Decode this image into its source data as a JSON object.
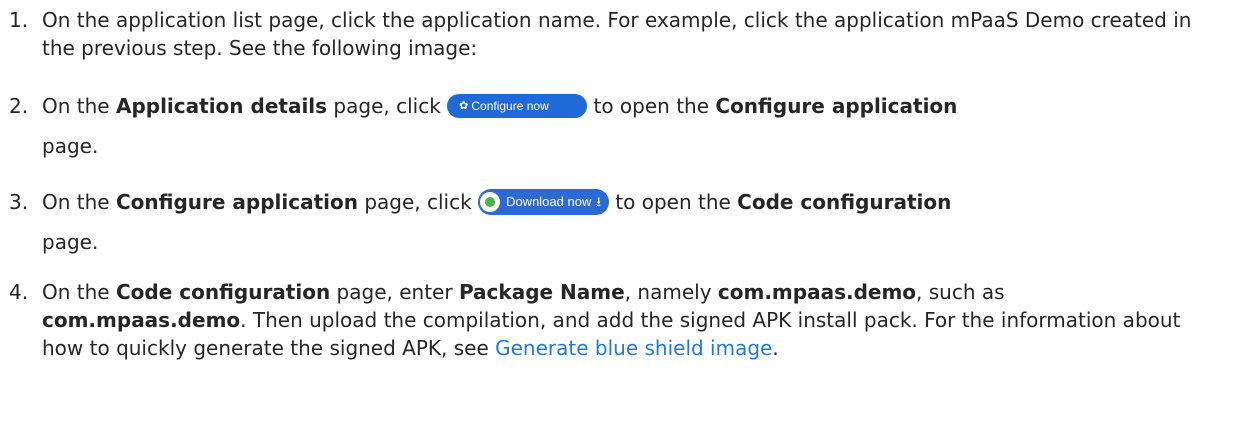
{
  "steps": [
    {
      "number": "1.",
      "text": "On the application list page, click the application name. For example, click the application mPaaS Demo created in the previous step. See the following image:"
    },
    {
      "number": "2.",
      "pre": "On the ",
      "bold1": "Application details",
      "mid": " page, click ",
      "button_label": "Configure now",
      "post": " to open the ",
      "bold2": "Configure application",
      "end": " page."
    },
    {
      "number": "3.",
      "pre": "On the ",
      "bold1": "Configure application",
      "mid": " page, click ",
      "button_label": "Download now",
      "post": " to open the ",
      "bold2": "Code configuration",
      "end": " page."
    },
    {
      "number": "4.",
      "pre": "On the ",
      "bold1": "Code configuration",
      "mid1": " page, enter ",
      "bold2": "Package Name",
      "mid2": ", namely ",
      "bold3": "com.mpaas.demo",
      "mid3": ", such as ",
      "bold4": "com.mpaas.demo",
      "mid4": ". Then upload the compilation, and add the signed APK install pack. For the information about how to quickly generate the signed APK, see ",
      "link": "Generate blue shield image",
      "end": "."
    }
  ],
  "colors": {
    "link": "#1f7ae0",
    "button": "#1f69d8"
  },
  "icons": {
    "configure": "gear-icon",
    "download": "download-arrow-icon",
    "app_logo": "app-logo-icon"
  }
}
